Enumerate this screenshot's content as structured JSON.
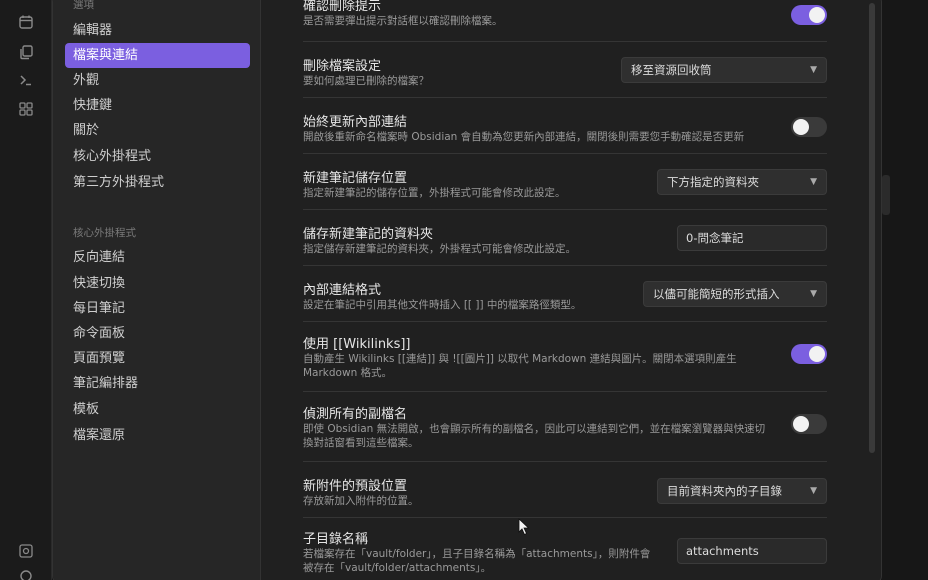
{
  "sidebar": {
    "partial_top": "選項",
    "items": [
      {
        "label": "編輯器"
      },
      {
        "label": "檔案與連結",
        "active": true
      },
      {
        "label": "外觀"
      },
      {
        "label": "快捷鍵"
      },
      {
        "label": "關於"
      },
      {
        "label": "核心外掛程式"
      },
      {
        "label": "第三方外掛程式"
      }
    ],
    "plugin_heading": "核心外掛程式",
    "plugin_items": [
      {
        "label": "反向連結"
      },
      {
        "label": "快速切換"
      },
      {
        "label": "每日筆記"
      },
      {
        "label": "命令面板"
      },
      {
        "label": "頁面預覽"
      },
      {
        "label": "筆記編排器"
      },
      {
        "label": "模板"
      },
      {
        "label": "檔案還原"
      }
    ]
  },
  "settings": [
    {
      "name": "確認刪除提示",
      "desc": "是否需要彈出提示對話框以確認刪除檔案。",
      "control": "toggle",
      "on": true
    },
    {
      "name": "刪除檔案設定",
      "desc": "要如何處理已刪除的檔案？",
      "control": "dropdown",
      "value": "移至資源回收筒"
    },
    {
      "name": "始終更新內部連結",
      "desc": "開啟後重新命名檔案時 Obsidian 會自動為您更新內部連結，關閉後則需要您手動確認是否更新",
      "control": "toggle",
      "on": false
    },
    {
      "name": "新建筆記儲存位置",
      "desc": "指定新建筆記的儲存位置，外掛程式可能會修改此設定。",
      "control": "dropdown",
      "value": "下方指定的資料夾"
    },
    {
      "name": "儲存新建筆記的資料夾",
      "desc": "指定儲存新建筆記的資料夾，外掛程式可能會修改此設定。",
      "control": "text",
      "value": "0-問念筆記"
    },
    {
      "name": "內部連結格式",
      "desc": "設定在筆記中引用其他文件時插入 [[ ]] 中的檔案路徑類型。",
      "control": "dropdown",
      "value": "以儘可能簡短的形式插入"
    },
    {
      "name": "使用 [[Wikilinks]]",
      "desc": "自動產生 Wikilinks [[連結]] 與 ![[圖片]] 以取代 Markdown 連結與圖片。關閉本選項則產生",
      "desc2": "Markdown 格式。",
      "control": "toggle",
      "on": true
    },
    {
      "name": "偵測所有的副檔名",
      "desc": "即使 Obsidian 無法開啟，也會顯示所有的副檔名，因此可以連結到它們，並在檔案瀏覽器與快速切",
      "desc2": "換對話窗看到這些檔案。",
      "control": "toggle",
      "on": false
    },
    {
      "name": "新附件的預設位置",
      "desc": "存放新加入附件的位置。",
      "control": "dropdown",
      "value": "目前資料夾內的子目錄"
    },
    {
      "name": "子目錄名稱",
      "desc": "若檔案存在「vault/folder」，且子目錄名稱為「attachments」，則附件會",
      "desc2": "被存在「vault/folder/attachments」。",
      "control": "text",
      "value": "attachments"
    }
  ],
  "colors": {
    "accent": "#7b5fe0",
    "background": "#202020",
    "sidebar": "#262626"
  }
}
